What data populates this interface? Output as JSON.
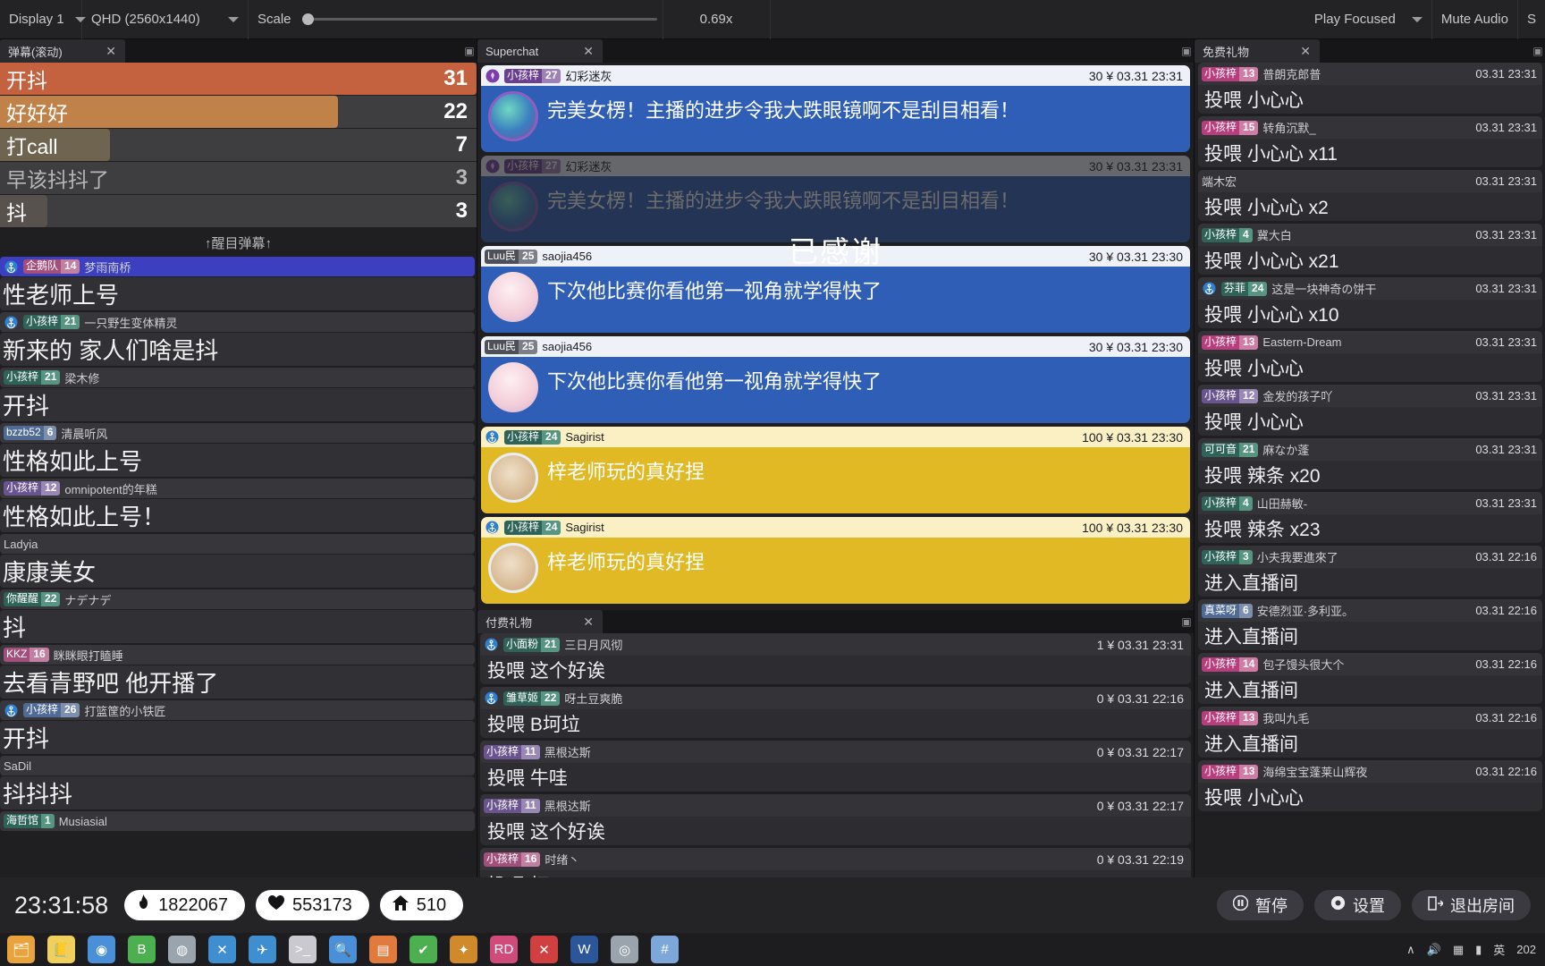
{
  "toolbar": {
    "display_label": "Display 1",
    "resolution_label": "QHD (2560x1440)",
    "scale_label": "Scale",
    "scale_value": "0.69x",
    "play_focused_label": "Play Focused",
    "mute_audio_label": "Mute Audio",
    "settings_label": "S"
  },
  "left_panel": {
    "tab_title": "弹幕(滚动)",
    "close_label": "✕",
    "section_title": "↑醒目弹幕↑",
    "ranking": [
      {
        "label": "开抖",
        "count": "31",
        "pct": 100,
        "color": "#c4613f",
        "dim": false
      },
      {
        "label": "好好好",
        "count": "22",
        "pct": 71,
        "color": "#c08249",
        "dim": false
      },
      {
        "label": "打call",
        "count": "7",
        "pct": 23,
        "color": "#6f6450",
        "dim": false
      },
      {
        "label": "早该抖抖了",
        "count": "3",
        "pct": 0,
        "color": "#4a4a4d",
        "dim": true
      },
      {
        "label": "抖",
        "count": "3",
        "pct": 10,
        "color": "#57524e",
        "dim": false
      }
    ],
    "messages": [
      {
        "medal_name": "企鹅队",
        "medal_lvl": "14",
        "medal_color": "#a34f7c",
        "lvl_color": "#c27fa1",
        "anchor": true,
        "user": "梦雨南桥",
        "text": "性老师上号",
        "highlight": true
      },
      {
        "medal_name": "小孩梓",
        "medal_lvl": "21",
        "medal_color": "#2e6358",
        "lvl_color": "#56957f",
        "anchor": true,
        "user": "一只野生变体精灵",
        "text": "新来的 家人们啥是抖",
        "highlight": false
      },
      {
        "medal_name": "小孩梓",
        "medal_lvl": "21",
        "medal_color": "#2e6358",
        "lvl_color": "#56957f",
        "anchor": false,
        "user": "梁木修",
        "text": "开抖",
        "highlight": false
      },
      {
        "medal_name": "bzzb52",
        "medal_lvl": "6",
        "medal_color": "#4e6a95",
        "lvl_color": "#7d8fae",
        "anchor": false,
        "user": "清晨听风",
        "text": "性格如此上号",
        "highlight": false
      },
      {
        "medal_name": "小孩梓",
        "medal_lvl": "12",
        "medal_color": "#6a5490",
        "lvl_color": "#9987b5",
        "anchor": false,
        "user": "omnipotent的年糕",
        "text": "性格如此上号！",
        "highlight": false
      },
      {
        "medal_name": "",
        "medal_lvl": "",
        "medal_color": "",
        "lvl_color": "",
        "anchor": false,
        "user": "Ladyia",
        "text": "康康美女",
        "highlight": false
      },
      {
        "medal_name": "你醒醒",
        "medal_lvl": "22",
        "medal_color": "#2e6358",
        "lvl_color": "#56957f",
        "anchor": false,
        "user": "ナデナデ",
        "text": "抖",
        "highlight": false
      },
      {
        "medal_name": "KKZ",
        "medal_lvl": "16",
        "medal_color": "#a34f7c",
        "lvl_color": "#c27fa1",
        "anchor": false,
        "user": "眯眯眼打瞌睡",
        "text": "去看青野吧 他开播了",
        "highlight": false
      },
      {
        "medal_name": "小孩梓",
        "medal_lvl": "26",
        "medal_color": "#4e6a95",
        "lvl_color": "#7d8fae",
        "anchor": true,
        "user": "打篮筐的小铁匠",
        "text": "开抖",
        "highlight": false
      },
      {
        "medal_name": "",
        "medal_lvl": "",
        "medal_color": "",
        "lvl_color": "",
        "anchor": false,
        "user": "SaDil",
        "text": "抖抖抖",
        "highlight": false
      },
      {
        "medal_name": "海哲馆",
        "medal_lvl": "1",
        "medal_color": "#2e6358",
        "lvl_color": "#56957f",
        "anchor": false,
        "user": "Musiasial",
        "text": "",
        "highlight": false
      }
    ]
  },
  "mid_panel": {
    "superchat_tab": "Superchat",
    "gift_tab": "付费礼物",
    "close_label": "✕",
    "thanks_overlay": "已感谢",
    "superchats": [
      {
        "medal_name": "小孩梓",
        "medal_lvl": "27",
        "medal_color": "#6a3f8f",
        "lvl_color": "#9b81b5",
        "badge": "captain",
        "user": "幻彩迷灰",
        "amount": "30 ¥",
        "time": "03.31 23:31",
        "text": "完美女楞！主播的进步令我大跌眼镜啊不是刮目相看！",
        "style": "blue",
        "ghost": false
      },
      {
        "medal_name": "小孩梓",
        "medal_lvl": "27",
        "medal_color": "#6a3f8f",
        "lvl_color": "#9b81b5",
        "badge": "captain",
        "user": "幻彩迷灰",
        "amount": "30 ¥",
        "time": "03.31 23:31",
        "text": "完美女楞！主播的进步令我大跌眼镜啊不是刮目相看！",
        "style": "blue",
        "ghost": true
      },
      {
        "medal_name": "Luu民",
        "medal_lvl": "25",
        "medal_color": "#4e5057",
        "lvl_color": "#7d7f88",
        "badge": "none",
        "user": "saojia456",
        "amount": "30 ¥",
        "time": "03.31 23:30",
        "text": "下次他比赛你看他第一视角就学得快了",
        "style": "blue",
        "ghost": false
      },
      {
        "medal_name": "Luu民",
        "medal_lvl": "25",
        "medal_color": "#4e5057",
        "lvl_color": "#7d7f88",
        "badge": "none",
        "user": "saojia456",
        "amount": "30 ¥",
        "time": "03.31 23:30",
        "text": "下次他比赛你看他第一视角就学得快了",
        "style": "blue",
        "ghost": false
      },
      {
        "medal_name": "小孩梓",
        "medal_lvl": "24",
        "medal_color": "#2e6358",
        "lvl_color": "#56957f",
        "badge": "anchor",
        "user": "Sagirist",
        "amount": "100 ¥",
        "time": "03.31 23:30",
        "text": "梓老师玩的真好捏",
        "style": "yellow",
        "ghost": false
      },
      {
        "medal_name": "小孩梓",
        "medal_lvl": "24",
        "medal_color": "#2e6358",
        "lvl_color": "#56957f",
        "badge": "anchor",
        "user": "Sagirist",
        "amount": "100 ¥",
        "time": "03.31 23:30",
        "text": "梓老师玩的真好捏",
        "style": "yellow",
        "ghost": false
      }
    ],
    "paid_gifts": [
      {
        "medal_name": "小面粉",
        "medal_lvl": "21",
        "medal_color": "#2e6358",
        "lvl_color": "#56957f",
        "anchor": true,
        "user": "三日月风彻",
        "amount": "1 ¥",
        "time": "03.31 23:31",
        "text": "投喂 这个好诶"
      },
      {
        "medal_name": "雏草姬",
        "medal_lvl": "22",
        "medal_color": "#2e6358",
        "lvl_color": "#56957f",
        "anchor": true,
        "user": "呀土豆爽脆",
        "amount": "0 ¥",
        "time": "03.31 22:16",
        "text": "投喂 B坷垃"
      },
      {
        "medal_name": "小孩梓",
        "medal_lvl": "11",
        "medal_color": "#6a5490",
        "lvl_color": "#9987b5",
        "anchor": false,
        "user": "黑根达斯",
        "amount": "0 ¥",
        "time": "03.31 22:17",
        "text": "投喂 牛哇"
      },
      {
        "medal_name": "小孩梓",
        "medal_lvl": "11",
        "medal_color": "#6a5490",
        "lvl_color": "#9987b5",
        "anchor": false,
        "user": "黑根达斯",
        "amount": "0 ¥",
        "time": "03.31 22:17",
        "text": "投喂 这个好诶"
      },
      {
        "medal_name": "小孩梓",
        "medal_lvl": "16",
        "medal_color": "#a34f7c",
        "lvl_color": "#c27fa1",
        "anchor": false,
        "user": "时绪丶",
        "amount": "0 ¥",
        "time": "03.31 22:19",
        "text": "投喂 打call"
      }
    ]
  },
  "right_panel": {
    "tab_title": "免费礼物",
    "close_label": "✕",
    "free_gifts": [
      {
        "medal_name": "小孩梓",
        "medal_lvl": "13",
        "medal_color": "#b83d7c",
        "lvl_color": "#d07ba5",
        "anchor": false,
        "user": "普朗克郎普",
        "time": "03.31 23:31",
        "text": "投喂 小心心"
      },
      {
        "medal_name": "小孩梓",
        "medal_lvl": "15",
        "medal_color": "#b83d7c",
        "lvl_color": "#d07ba5",
        "anchor": false,
        "user": "转角沉默_",
        "time": "03.31 23:31",
        "text": "投喂 小心心 x11"
      },
      {
        "medal_name": "",
        "medal_lvl": "",
        "medal_color": "",
        "lvl_color": "",
        "anchor": false,
        "user": "端木宏",
        "time": "03.31 23:31",
        "text": "投喂 小心心 x2"
      },
      {
        "medal_name": "小孩梓",
        "medal_lvl": "4",
        "medal_color": "#2e6358",
        "lvl_color": "#56957f",
        "anchor": false,
        "user": "冀大白",
        "time": "03.31 23:31",
        "text": "投喂 小心心 x21"
      },
      {
        "medal_name": "芬菲",
        "medal_lvl": "24",
        "medal_color": "#2e6358",
        "lvl_color": "#56957f",
        "anchor": true,
        "user": "这是一块神奇の饼干",
        "time": "03.31 23:31",
        "text": "投喂 小心心 x10"
      },
      {
        "medal_name": "小孩梓",
        "medal_lvl": "13",
        "medal_color": "#b83d7c",
        "lvl_color": "#d07ba5",
        "anchor": false,
        "user": "Eastern-Dream",
        "time": "03.31 23:31",
        "text": "投喂 小心心"
      },
      {
        "medal_name": "小孩梓",
        "medal_lvl": "12",
        "medal_color": "#6a5490",
        "lvl_color": "#9987b5",
        "anchor": false,
        "user": "金发的孩子吖",
        "time": "03.31 23:31",
        "text": "投喂 小心心"
      },
      {
        "medal_name": "可可音",
        "medal_lvl": "21",
        "medal_color": "#2e6358",
        "lvl_color": "#56957f",
        "anchor": false,
        "user": "麻なか蓬",
        "time": "03.31 23:31",
        "text": "投喂 辣条 x20"
      },
      {
        "medal_name": "小孩梓",
        "medal_lvl": "4",
        "medal_color": "#2e6358",
        "lvl_color": "#56957f",
        "anchor": false,
        "user": "山田赫敏-",
        "time": "03.31 23:31",
        "text": "投喂 辣条 x23"
      },
      {
        "medal_name": "小孩梓",
        "medal_lvl": "3",
        "medal_color": "#2e6358",
        "lvl_color": "#56957f",
        "anchor": false,
        "user": "小夫我要進來了",
        "time": "03.31 22:16",
        "text": "进入直播间"
      },
      {
        "medal_name": "真菜呀",
        "medal_lvl": "6",
        "medal_color": "#4e6a95",
        "lvl_color": "#7d8fae",
        "anchor": false,
        "user": "安德烈亚·多利亚。",
        "time": "03.31 22:16",
        "text": "进入直播间"
      },
      {
        "medal_name": "小孩梓",
        "medal_lvl": "14",
        "medal_color": "#b83d7c",
        "lvl_color": "#d07ba5",
        "anchor": false,
        "user": "包子馒头很大个",
        "time": "03.31 22:16",
        "text": "进入直播间"
      },
      {
        "medal_name": "小孩梓",
        "medal_lvl": "13",
        "medal_color": "#b83d7c",
        "lvl_color": "#d07ba5",
        "anchor": false,
        "user": "我叫九毛",
        "time": "03.31 22:16",
        "text": "进入直播间"
      },
      {
        "medal_name": "小孩梓",
        "medal_lvl": "13",
        "medal_color": "#b83d7c",
        "lvl_color": "#d07ba5",
        "anchor": false,
        "user": "海绵宝宝蓬莱山辉夜",
        "time": "03.31 22:16",
        "text": "投喂 小心心"
      }
    ]
  },
  "bottom": {
    "clock": "23:31:58",
    "popularity_value": "1822067",
    "likes_value": "553173",
    "rooms_value": "510",
    "pause_label": "暂停",
    "settings_label": "设置",
    "exit_label": "退出房间"
  },
  "taskbar": {
    "items": [
      {
        "name": "file-explorer-icon",
        "glyph": "🗂",
        "color": "#e8a33d"
      },
      {
        "name": "notes-icon",
        "glyph": "📒",
        "color": "#f0cf5a"
      },
      {
        "name": "chrome-icon",
        "glyph": "◉",
        "color": "#4a90d9"
      },
      {
        "name": "box-app-icon",
        "glyph": "B",
        "color": "#4caf50"
      },
      {
        "name": "firefox-icon",
        "glyph": "◍",
        "color": "#9aa4ad"
      },
      {
        "name": "vscode-icon",
        "glyph": "✕",
        "color": "#3f8fd0"
      },
      {
        "name": "telegram-icon",
        "glyph": "✈",
        "color": "#3f8fd0"
      },
      {
        "name": "terminal-icon",
        "glyph": ">_",
        "color": "#c9c9cf"
      },
      {
        "name": "search-app-icon",
        "glyph": "🔍",
        "color": "#4a90d9"
      },
      {
        "name": "media-app-icon",
        "glyph": "▤",
        "color": "#e07a3d"
      },
      {
        "name": "checkmark-icon",
        "glyph": "✔",
        "color": "#4caf50"
      },
      {
        "name": "blender-icon",
        "glyph": "✦",
        "color": "#d08a2a"
      },
      {
        "name": "rider-icon",
        "glyph": "RD",
        "color": "#d04a7a"
      },
      {
        "name": "xmind-icon",
        "glyph": "✕",
        "color": "#d04040"
      },
      {
        "name": "word-icon",
        "glyph": "W",
        "color": "#2b579a"
      },
      {
        "name": "globe-icon",
        "glyph": "◎",
        "color": "#9aa4ad"
      },
      {
        "name": "hash-icon",
        "glyph": "#",
        "color": "#7da6d9"
      }
    ],
    "tray": {
      "up_arrow": "∧",
      "volume": "🔊",
      "network": "▦",
      "battery": "▮",
      "lang": "英",
      "clock": "202"
    }
  }
}
